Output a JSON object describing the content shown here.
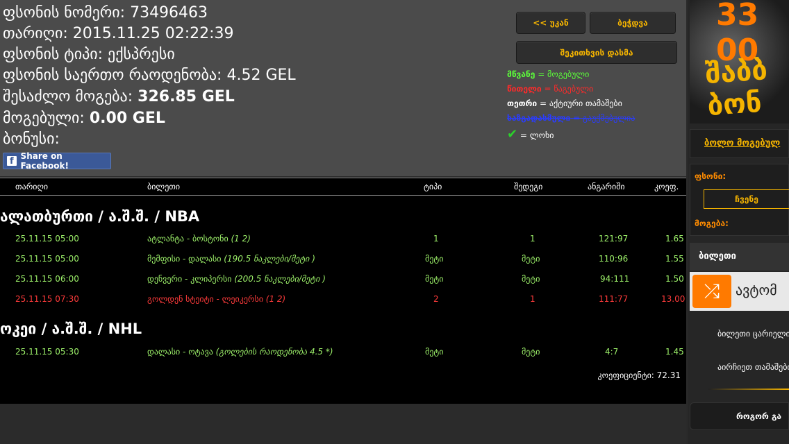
{
  "info": {
    "ticket_number": "ფსონის ნომერი: 73496463",
    "date": "თარიღი: 2015.11.25 02:22:39",
    "bet_type": "ფსონის ტიპი: ექსპრესი",
    "total_stake_label": "ფსონის საერთო რაოდენობა:",
    "total_stake_value": "4.52 GEL",
    "possible_win_label": "შესაძლო მოგება:",
    "possible_win_value": "326.85 GEL",
    "won_label": "მოგებული:",
    "won_value": "0.00 GEL",
    "bonus_label": "ბონუსი:"
  },
  "facebook_share": "Share on Facebook!",
  "buttons": {
    "back": "<< უკან",
    "print": "ბეჭდვა",
    "check": "შეკითხვის დასმა"
  },
  "legend": [
    {
      "term": "მწვანე",
      "desc": "= მოგებული",
      "color": "#5cff3a"
    },
    {
      "term": "წითელი",
      "desc": "= წაგებული",
      "color": "#ff2a2a"
    },
    {
      "term": "თეთრი",
      "desc": "= აქტიური თამაშები",
      "color": "#ffffff"
    },
    {
      "term": "ხაზგადასმული",
      "desc": "= გაუქმებულია",
      "color": "#2a3cff"
    },
    {
      "term": "✔",
      "desc": "= ლოხი",
      "color": "#2bd12b"
    }
  ],
  "table": {
    "headers": {
      "date": "თარიღი",
      "ticket": "ბილეთი",
      "type": "ტიპი",
      "result": "შედეგი",
      "account": "ანგარიში",
      "coef": "კოეფ."
    },
    "groups": [
      {
        "title": "ალათბურთი / ა.შ.შ. / NBA",
        "rows": [
          {
            "date": "25.11.15 05:00",
            "match": "ატლანტა - ბოსტონი",
            "detail": "(1 2)",
            "type": "1",
            "result": "1",
            "account": "121:97",
            "coef": "1.65",
            "status": "won"
          },
          {
            "date": "25.11.15 05:00",
            "match": "მემფისი - დალასი",
            "detail": "(190.5 ნაკლები/მეტი )",
            "type": "მეტი",
            "result": "მეტი",
            "account": "110:96",
            "coef": "1.55",
            "status": "won"
          },
          {
            "date": "25.11.15 06:00",
            "match": "დენვერი - კლიპერსი",
            "detail": "(200.5 ნაკლები/მეტი )",
            "type": "მეტი",
            "result": "მეტი",
            "account": "94:111",
            "coef": "1.50",
            "status": "won"
          },
          {
            "date": "25.11.15 07:30",
            "match": "გოლდენ სტეიტი - ლეიკერსი",
            "detail": "(1 2)",
            "type": "2",
            "result": "1",
            "account": "111:77",
            "coef": "13.00",
            "status": "lost"
          }
        ]
      },
      {
        "title": "ოკეი / ა.შ.შ. / NHL",
        "rows": [
          {
            "date": "25.11.15 05:30",
            "match": "დალასი - ოტავა",
            "detail": "(გოლების რაოდენობა 4.5 *)",
            "type": "მეტი",
            "result": "მეტი",
            "account": "4:7",
            "coef": "1.45",
            "status": "won"
          }
        ]
      }
    ],
    "total": "კოეფიციენტი: 72.31"
  },
  "sidebar": {
    "banner_number": "33 00",
    "banner_text": "შაბბ ბონ",
    "last_winners": "ბოლო მოგებულ",
    "bet_label": "ფსონი:",
    "bet_button": "ჩვენე",
    "win_label": "მოგება:",
    "ticket_title": "ბილეთი",
    "auto_label": "ავტომ",
    "ticket_empty": "ბილეთი ცარიელია",
    "pick_games": "აირჩიეთ თამაშები",
    "how_to": "როგორ გა"
  }
}
